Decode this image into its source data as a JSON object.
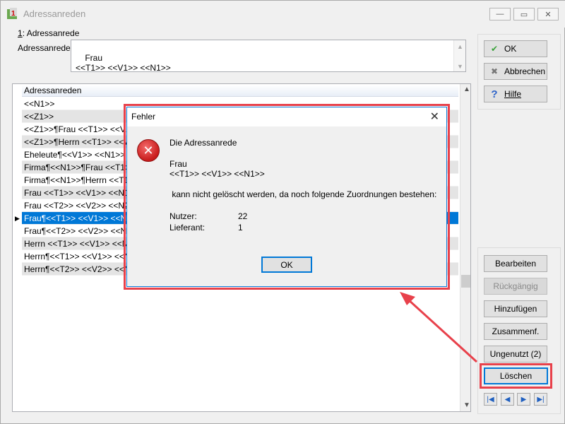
{
  "window": {
    "title": "Adressanreden",
    "controls": {
      "minimize": "—",
      "maximize": "▭",
      "close": "✕"
    }
  },
  "editor": {
    "group_number": "1",
    "group_label": ": Adressanrede",
    "field_label": "Adressanrede:",
    "value": "Frau\n<<T1>> <<V1>> <<N1>>"
  },
  "buttons": {
    "ok": "OK",
    "cancel": "Abbrechen",
    "help": "Hilfe",
    "edit": "Bearbeiten",
    "undo": "Rückgängig",
    "add": "Hinzufügen",
    "merge": "Zusammenf.",
    "unused": "Ungenutzt (2)",
    "delete": "Löschen"
  },
  "grid": {
    "header": "Adressanreden",
    "rows": [
      "<<N1>>",
      "<<Z1>>",
      "<<Z1>>¶Frau <<T1>> <<V1>>",
      "<<Z1>>¶Herrn <<T1>> <<V1>>",
      "Eheleute¶<<V1>> <<N1>>",
      "Firma¶<<N1>>¶Frau <<T1>> <<",
      "Firma¶<<N1>>¶Herrn <<T1>>",
      "Frau <<T1>> <<V1>> <<N1>>¶",
      "Frau <<T2>> <<V2>> <<N2>>¶",
      "Frau¶<<T1>> <<V1>> <<N1>>",
      "Frau¶<<T2>> <<V2>> <<N2>>",
      "Herrn <<T1>> <<V1>> <<N1",
      "Herrn¶<<T1>> <<V1>> <<N1>>",
      "Herrn¶<<T2>> <<V2>> <<N2>>"
    ],
    "selected_index": 9
  },
  "dialog": {
    "title": "Fehler",
    "line1": "Die Adressanrede",
    "line2": "Frau",
    "line3": "<<T1>> <<V1>> <<N1>>",
    "line4": " kann nicht gelöscht werden, da noch folgende Zuordnungen bestehen:",
    "k1": "Nutzer:",
    "v1": "22",
    "k2": "Lieferant:",
    "v2": "1",
    "ok": "OK",
    "close": "✕"
  },
  "icons": {
    "ok": "check-icon",
    "cancel": "cross-icon",
    "help": "question-icon",
    "error": "error-icon",
    "nav": [
      "first-icon",
      "prev-icon",
      "next-icon",
      "last-icon"
    ]
  },
  "colors": {
    "highlight": "#e8414b",
    "selection": "#0078d7"
  }
}
